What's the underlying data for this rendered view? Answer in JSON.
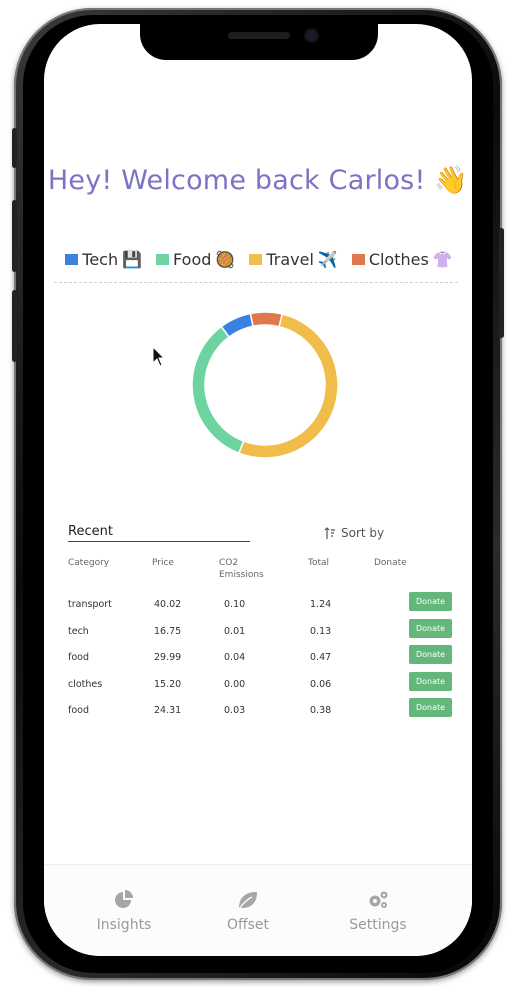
{
  "greeting": {
    "text": "Hey! Welcome back Carlos! 👋"
  },
  "legend": [
    {
      "label": "Tech",
      "emoji": "💾",
      "color": "#3b82e0"
    },
    {
      "label": "Food",
      "emoji": "🥘",
      "color": "#6dd3a0"
    },
    {
      "label": "Travel",
      "emoji": "✈️",
      "color": "#f0bc4a"
    },
    {
      "label": "Clothes",
      "emoji": "👚",
      "color": "#e0784e"
    }
  ],
  "chart_data": {
    "type": "pie",
    "style": "donut",
    "categories": [
      "Food",
      "Tech",
      "Clothes",
      "Travel"
    ],
    "values": [
      34,
      7,
      7,
      52
    ],
    "colors": [
      "#6dd3a0",
      "#3b82e0",
      "#e0784e",
      "#f0bc4a"
    ]
  },
  "recent": {
    "title": "Recent",
    "sort_label": "Sort by",
    "columns": {
      "category": "Category",
      "price": "Price",
      "co2": "CO2 Emissions",
      "total": "Total",
      "donate": "Donate"
    },
    "rows": [
      {
        "category": "transport",
        "price": "40.02",
        "co2": "0.10",
        "total": "1.24",
        "action": "Donate"
      },
      {
        "category": "tech",
        "price": "16.75",
        "co2": "0.01",
        "total": "0.13",
        "action": "Donate"
      },
      {
        "category": "food",
        "price": "29.99",
        "co2": "0.04",
        "total": "0.47",
        "action": "Donate"
      },
      {
        "category": "clothes",
        "price": "15.20",
        "co2": "0.00",
        "total": "0.06",
        "action": "Donate"
      },
      {
        "category": "food",
        "price": "24.31",
        "co2": "0.03",
        "total": "0.38",
        "action": "Donate"
      }
    ]
  },
  "tabs": [
    {
      "label": "Insights",
      "icon": "pie-chart-icon"
    },
    {
      "label": "Offset",
      "icon": "leaf-icon"
    },
    {
      "label": "Settings",
      "icon": "gears-icon"
    }
  ]
}
